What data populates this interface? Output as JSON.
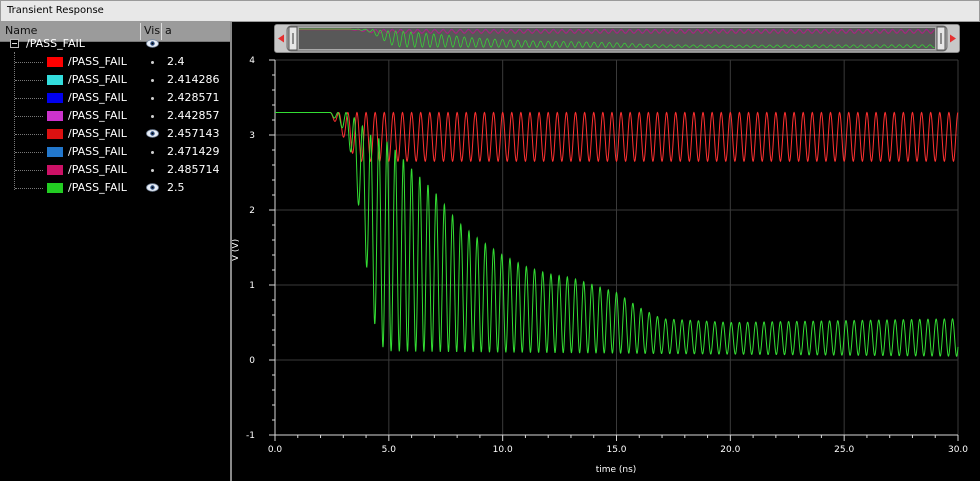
{
  "window": {
    "title": "Transient Response"
  },
  "legend": {
    "columns": {
      "name": "Name",
      "vis": "Vis",
      "a": "a"
    },
    "group": {
      "label": "/PASS_FAIL",
      "visible": true
    },
    "series_rows": [
      {
        "label": "/PASS_FAIL",
        "color": "#ff0000",
        "visible": false,
        "value": "2.4"
      },
      {
        "label": "/PASS_FAIL",
        "color": "#33dddd",
        "visible": false,
        "value": "2.414286"
      },
      {
        "label": "/PASS_FAIL",
        "color": "#0000ee",
        "visible": false,
        "value": "2.428571"
      },
      {
        "label": "/PASS_FAIL",
        "color": "#cc33cc",
        "visible": false,
        "value": "2.442857"
      },
      {
        "label": "/PASS_FAIL",
        "color": "#dd1111",
        "visible": true,
        "value": "2.457143"
      },
      {
        "label": "/PASS_FAIL",
        "color": "#2277cc",
        "visible": false,
        "value": "2.471429"
      },
      {
        "label": "/PASS_FAIL",
        "color": "#cc1166",
        "visible": false,
        "value": "2.485714"
      },
      {
        "label": "/PASS_FAIL",
        "color": "#22cc22",
        "visible": true,
        "value": "2.5"
      }
    ]
  },
  "chart_data": {
    "type": "line",
    "xlabel": "time (ns)",
    "ylabel": "V (V)",
    "xlim": [
      0,
      30
    ],
    "ylim": [
      -1,
      4
    ],
    "x_ticks": [
      "0.0",
      "5.0",
      "10.0",
      "15.0",
      "20.0",
      "25.0",
      "30.0"
    ],
    "y_ticks": [
      "-1",
      "0",
      "1",
      "2",
      "3",
      "4"
    ],
    "grid": true,
    "background": "#000000",
    "series": [
      {
        "color": "#ff3030",
        "description_points": [
          [
            0,
            3.3
          ],
          [
            2.4,
            3.3
          ],
          [
            3.5,
            3.05
          ],
          [
            30,
            3.0
          ]
        ],
        "oscillation": {
          "start": 2.4,
          "period": 0.4,
          "min": 2.65,
          "max": 3.3
        }
      },
      {
        "color": "#33dd33",
        "envelope_low": [
          [
            0,
            3.3
          ],
          [
            2.4,
            3.3
          ],
          [
            3.2,
            3.0
          ],
          [
            3.8,
            1.8
          ],
          [
            4.3,
            0.55
          ],
          [
            4.8,
            0.12
          ],
          [
            30,
            0.05
          ]
        ],
        "envelope_high": [
          [
            0,
            3.3
          ],
          [
            3.2,
            3.3
          ],
          [
            3.6,
            3.2
          ],
          [
            4.2,
            3.0
          ],
          [
            5.0,
            2.9
          ],
          [
            6.0,
            2.55
          ],
          [
            7.0,
            2.25
          ],
          [
            8.0,
            1.85
          ],
          [
            9.0,
            1.6
          ],
          [
            10.0,
            1.4
          ],
          [
            11.0,
            1.25
          ],
          [
            12.0,
            1.15
          ],
          [
            13.0,
            1.1
          ],
          [
            14.0,
            1.0
          ],
          [
            15.0,
            0.9
          ],
          [
            16.0,
            0.7
          ],
          [
            17.0,
            0.55
          ],
          [
            20.0,
            0.5
          ],
          [
            30.0,
            0.55
          ]
        ],
        "oscillation": {
          "start": 2.4,
          "period": 0.36
        }
      }
    ]
  }
}
